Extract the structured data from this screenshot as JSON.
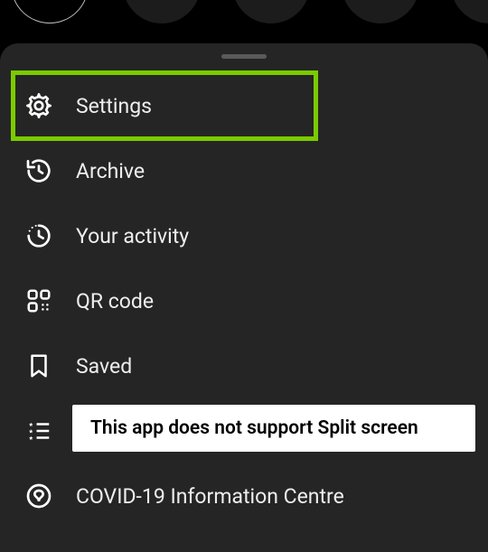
{
  "menu": {
    "items": [
      {
        "icon": "settings-icon",
        "label": "Settings"
      },
      {
        "icon": "archive-icon",
        "label": "Archive"
      },
      {
        "icon": "activity-icon",
        "label": "Your activity"
      },
      {
        "icon": "qr-icon",
        "label": "QR code"
      },
      {
        "icon": "saved-icon",
        "label": "Saved"
      },
      {
        "icon": "close-friends-icon",
        "label": ""
      },
      {
        "icon": "covid-icon",
        "label": "COVID-19 Information Centre"
      }
    ]
  },
  "toast": {
    "message": "This app does not support Split screen"
  },
  "highlight": {
    "target_index": 0,
    "color": "#7ACB00"
  }
}
